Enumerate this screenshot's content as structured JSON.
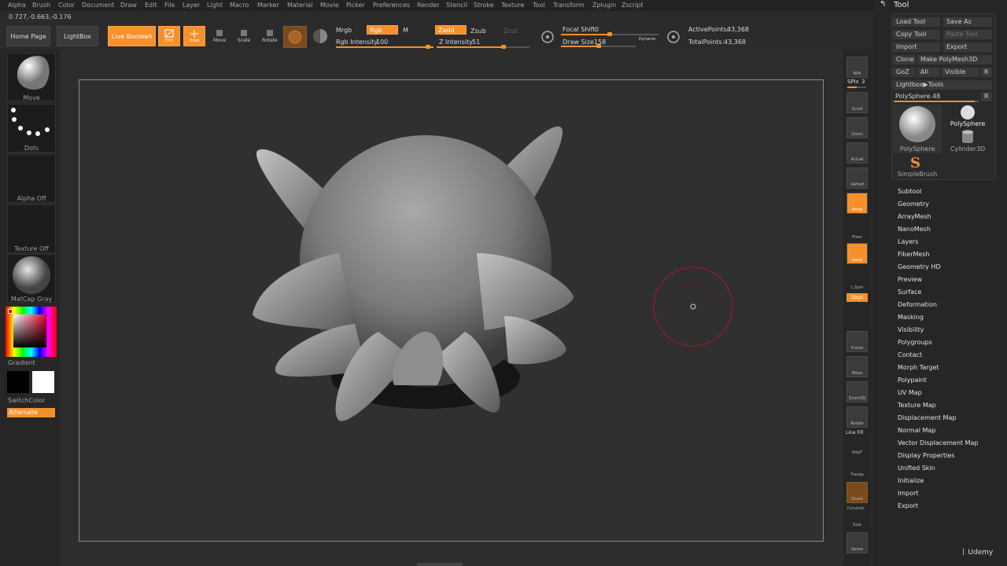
{
  "menu": [
    "Alpha",
    "Brush",
    "Color",
    "Document",
    "Draw",
    "Edit",
    "File",
    "Layer",
    "Light",
    "Macro",
    "Marker",
    "Material",
    "Movie",
    "Picker",
    "Preferences",
    "Render",
    "Stencil",
    "Stroke",
    "Texture",
    "Tool",
    "Transform",
    "Zplugin",
    "Zscript"
  ],
  "coords": "0.727,-0.663,-0.176",
  "toolbar": {
    "home": "Home Page",
    "lightbox": "LightBox",
    "liveboolean": "Live Boolean",
    "edit": "Edit",
    "draw": "Draw",
    "move": "Move",
    "scale": "Scale",
    "rotate": "Rotate",
    "mrgb": "Mrgb",
    "rgb": "Rgb",
    "m": "M",
    "zadd": "Zadd",
    "zsub": "Zsub",
    "zcut": "Zcut",
    "rgb_intensity_label": "Rgb Intensity",
    "rgb_intensity": "100",
    "z_intensity_label": "Z Intensity",
    "z_intensity": "51",
    "focal_label": "Focal Shift",
    "focal": "0",
    "draw_size_label": "Draw Size",
    "draw_size": "158",
    "dynamic": "Dynamic",
    "active_points_label": "ActivePoints:",
    "active_points": "43,368",
    "total_points_label": "TotalPoints:",
    "total_points": "43,368"
  },
  "leftshelf": {
    "move": "Move",
    "dots": "Dots",
    "alpha": "Alpha Off",
    "texture": "Texture Off",
    "matcap": "MatCap Gray",
    "gradient": "Gradient",
    "switchcolor": "SwitchColor",
    "alternate": "Alternate"
  },
  "rightshelf": {
    "bpr": "BPR",
    "spix_label": "SPix",
    "spix": "3",
    "scroll": "Scroll",
    "zoom": "Zoom",
    "actual": "Actual",
    "aahalf": "AAHalf",
    "dynamic": "Dynamic",
    "persp": "Persp",
    "floor": "Floor",
    "local": "Local",
    "lsym": "L.Sym",
    "xyz": "Qxyz",
    "frame": "Frame",
    "move": "Move",
    "zoom3d": "Zoom3D",
    "rotate": "Rotate",
    "linefill": "Line Fill",
    "polyf": "PolyF",
    "transp": "Transp",
    "ghost": "Ghost",
    "solo": "Solo",
    "xpose": "Xpose"
  },
  "tool": {
    "title": "Tool",
    "load": "Load Tool",
    "save": "Save As",
    "copy": "Copy Tool",
    "paste": "Paste Tool",
    "import": "Import",
    "export": "Export",
    "clone": "Clone",
    "makepoly": "Make PolyMesh3D",
    "goz": "GoZ",
    "all": "All",
    "visible": "Visible",
    "r": "R",
    "lightbox_tools": "Lightbox▶Tools",
    "polysphere_slider_label": "PolySphere.",
    "polysphere_slider": "48",
    "thumb_polysphere": "PolySphere",
    "thumb_polysphere_small": "PolySphere",
    "thumb_cylinder": "Cylinder3D",
    "thumb_simplebrush": "SimpleBrush",
    "sections": [
      "Subtool",
      "Geometry",
      "ArrayMesh",
      "NanoMesh",
      "Layers",
      "FiberMesh",
      "Geometry HD",
      "Preview",
      "Surface",
      "Deformation",
      "Masking",
      "Visibility",
      "Polygroups",
      "Contact",
      "Morph Target",
      "Polypaint",
      "UV Map",
      "Texture Map",
      "Displacement Map",
      "Normal Map",
      "Vector Displacement Map",
      "Display Properties",
      "Unified Skin",
      "Initialize",
      "Import",
      "Export"
    ]
  },
  "watermark": "Udemy",
  "colors": {
    "accent": "#f7902b",
    "background": "#2b2b2b",
    "brush_ring": "#8a1e2a"
  }
}
